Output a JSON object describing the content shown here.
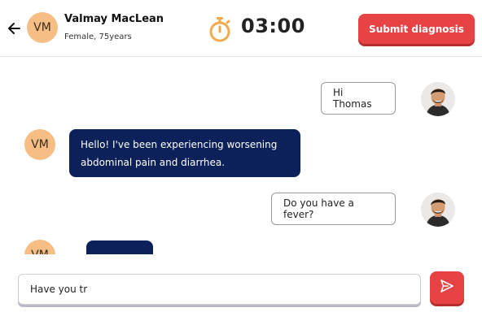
{
  "header": {
    "back_icon": "arrow-left-icon",
    "patient_initials": "VM",
    "patient_name": "Valmay MacLean",
    "patient_meta": "Female, 75years",
    "timer_icon": "stopwatch-icon",
    "timer": "03:00",
    "submit_label": "Submit diagnosis"
  },
  "messages": [
    {
      "from": "doctor",
      "text": "Hi Thomas"
    },
    {
      "from": "patient",
      "initials": "VM",
      "text": "Hello! I've been experiencing worsening abdominal pain and diarrhea."
    },
    {
      "from": "doctor",
      "text": "Do you have a fever?"
    },
    {
      "from": "patient",
      "initials": "VM",
      "text": ""
    }
  ],
  "composer": {
    "value": "Have you tr",
    "send_icon": "send-icon"
  },
  "colors": {
    "accent": "#e84344",
    "patient_bubble": "#0c2059",
    "avatar": "#f6be84",
    "timer_icon": "#f3a94d"
  }
}
